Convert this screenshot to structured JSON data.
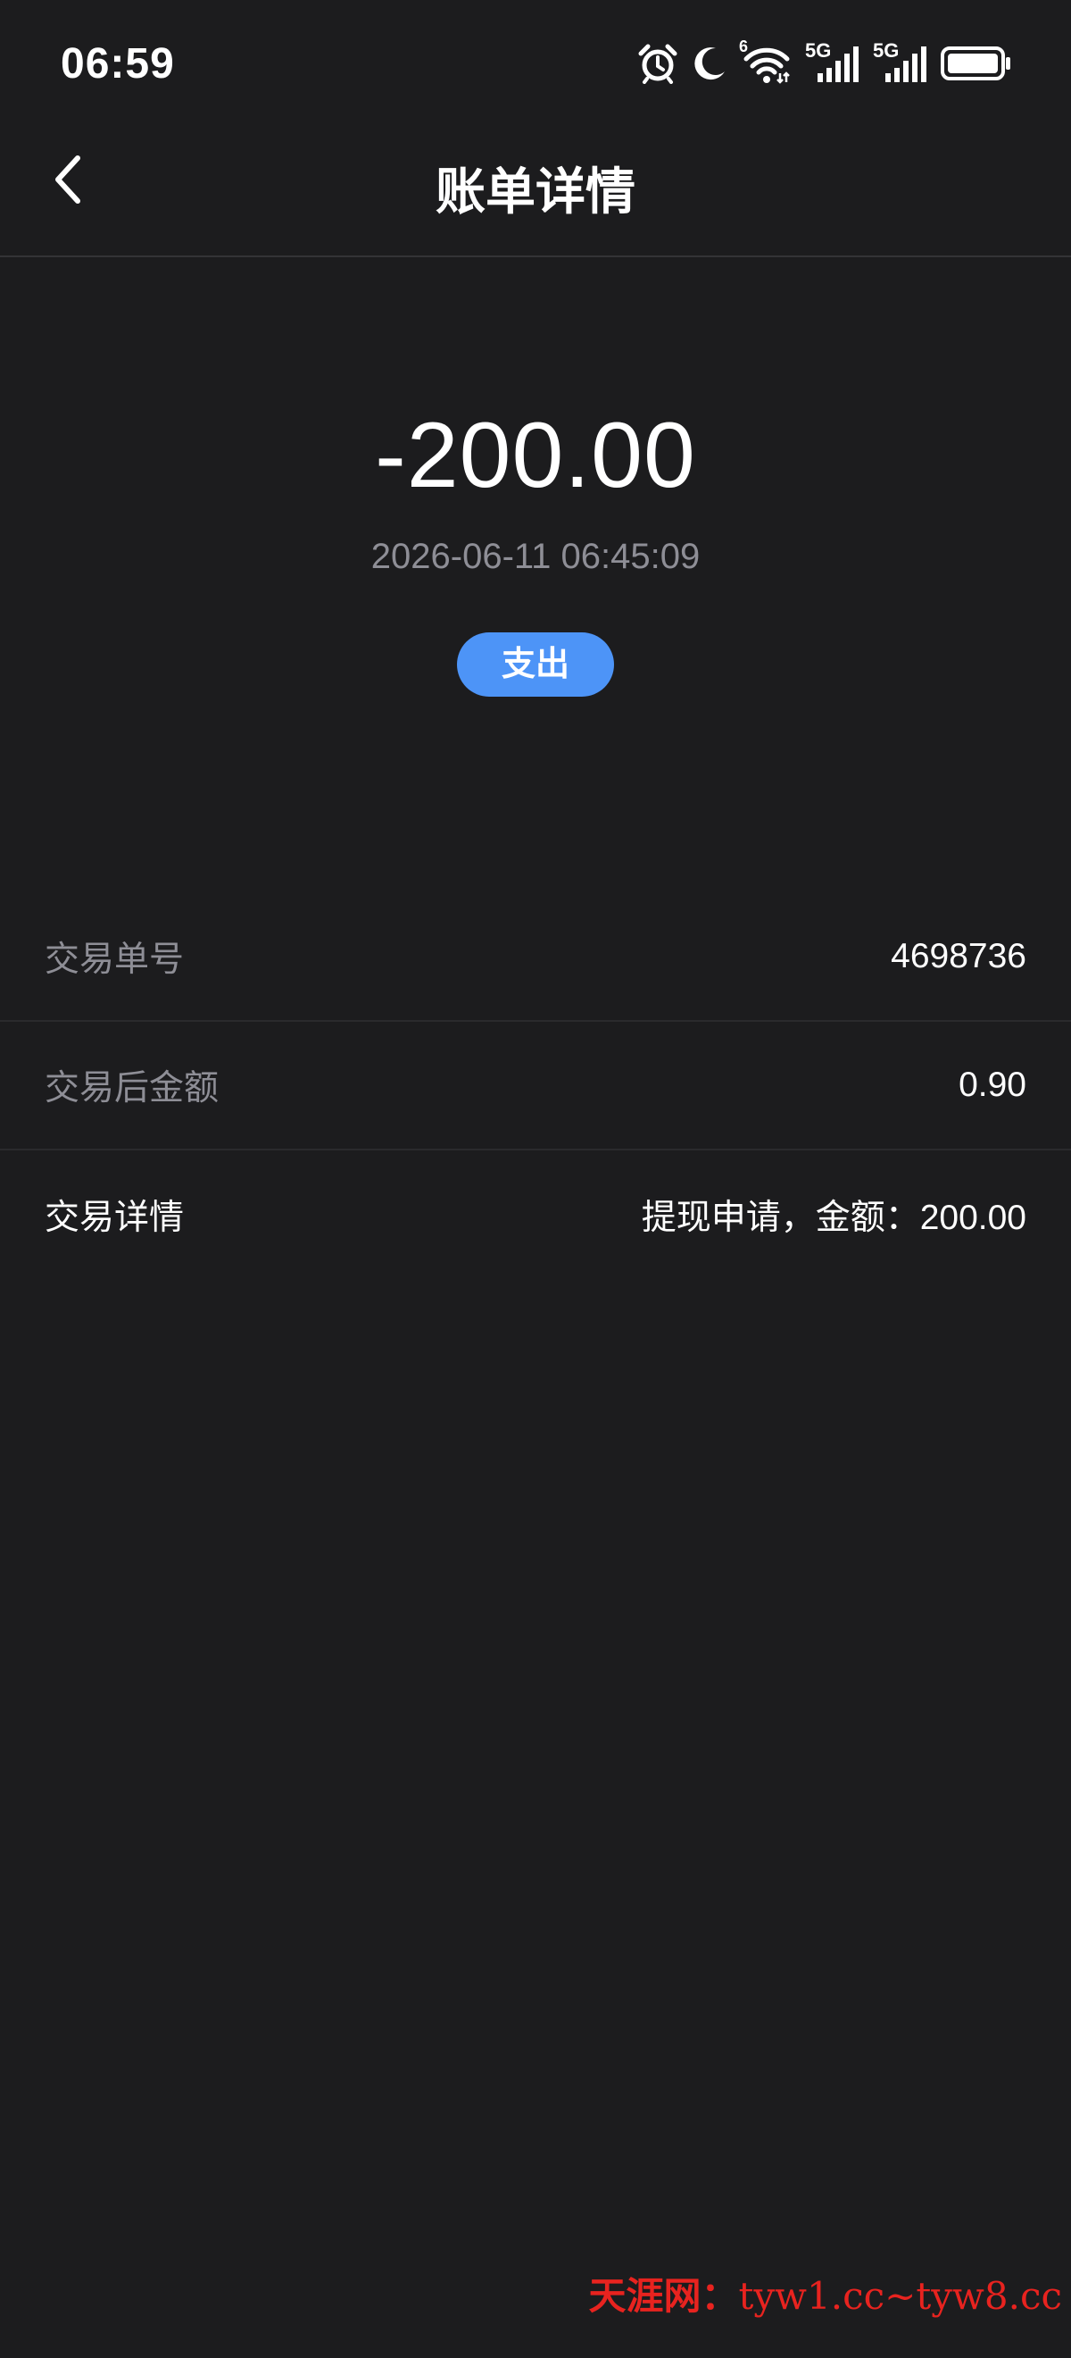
{
  "status_bar": {
    "time": "06:59",
    "wifi_badge": "6",
    "sim1_label": "5G",
    "sim2_label": "5G"
  },
  "header": {
    "title": "账单详情",
    "back_icon": "chevron-left-icon"
  },
  "summary": {
    "amount": "-200.00",
    "datetime": "2026-06-11 06:45:09",
    "type_label": "支出"
  },
  "details": [
    {
      "label": "交易单号",
      "value": "4698736"
    },
    {
      "label": "交易后金额",
      "value": "0.90"
    },
    {
      "label": "交易详情",
      "value": "提现申请，金额：200.00"
    }
  ],
  "watermark": {
    "site_name": "天涯网：",
    "urls": "tyw1.cc~tyw8.cc"
  },
  "colors": {
    "background": "#1c1c1e",
    "badge": "#4d94f7",
    "muted_text": "#8e8e96",
    "watermark": "#e8231f"
  }
}
